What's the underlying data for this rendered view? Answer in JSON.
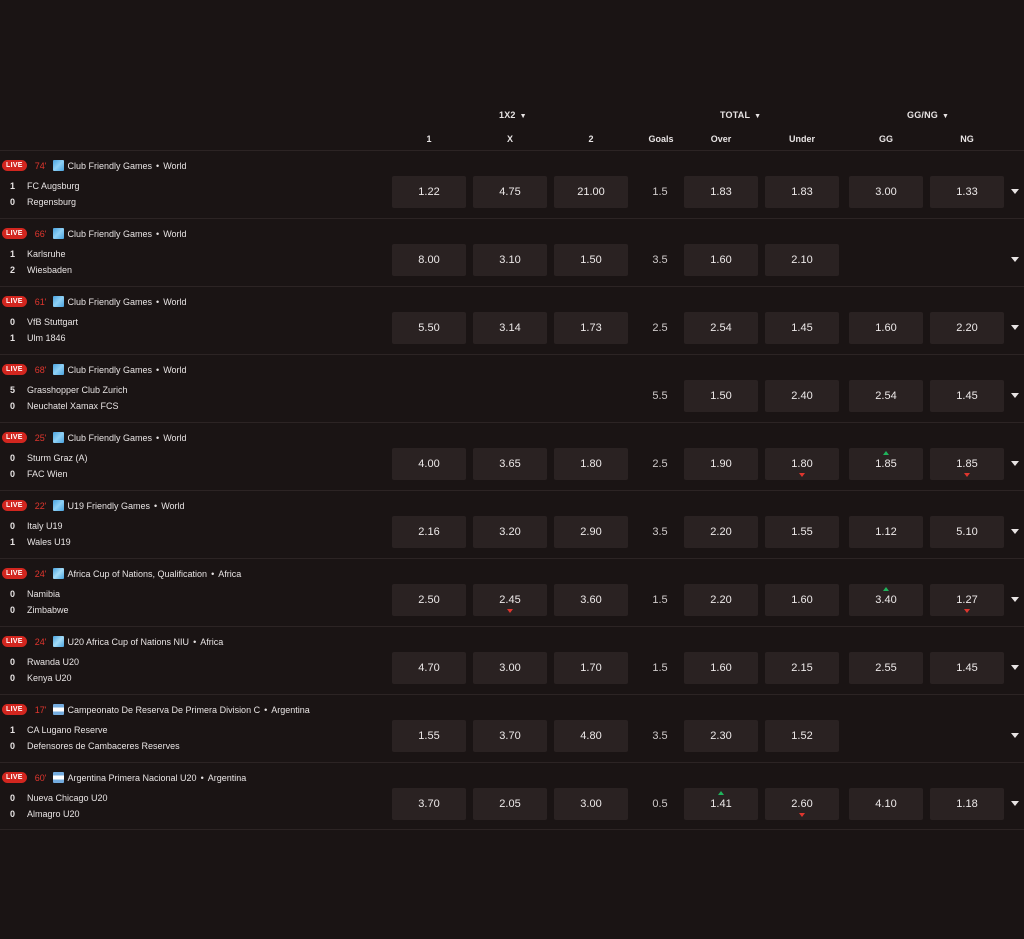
{
  "header": {
    "groups": [
      {
        "label": "1X2",
        "arrow": "▼"
      },
      {
        "label": "TOTAL",
        "arrow": "▼"
      },
      {
        "label": "GG/NG",
        "arrow": "▼"
      }
    ],
    "columns": [
      "1",
      "X",
      "2",
      "Goals",
      "Over",
      "Under",
      "GG",
      "NG"
    ]
  },
  "live_label": "LIVE",
  "colors": {
    "live_badge": "#d2261f",
    "up": "#1fb55c",
    "down": "#e0362e",
    "odds_bg": "#2a2222",
    "page_bg": "#1a1414"
  },
  "matches": [
    {
      "minute": "74'",
      "flag": "world-flag",
      "league": "Club Friendly Games",
      "sep": "•",
      "region": "World",
      "team1": {
        "score": "1",
        "name": "FC Augsburg"
      },
      "team2": {
        "score": "0",
        "name": "Regensburg"
      },
      "odds": {
        "one": "1.22",
        "x": "4.75",
        "two": "21.00",
        "goals": "1.5",
        "over": "1.83",
        "under": "1.83",
        "gg": "3.00",
        "ng": "1.33"
      }
    },
    {
      "minute": "66'",
      "flag": "world-flag",
      "league": "Club Friendly Games",
      "sep": "•",
      "region": "World",
      "team1": {
        "score": "1",
        "name": "Karlsruhe"
      },
      "team2": {
        "score": "2",
        "name": "Wiesbaden"
      },
      "odds": {
        "one": "8.00",
        "x": "3.10",
        "two": "1.50",
        "goals": "3.5",
        "over": "1.60",
        "under": "2.10",
        "gg": null,
        "ng": null
      }
    },
    {
      "minute": "61'",
      "flag": "world-flag",
      "league": "Club Friendly Games",
      "sep": "•",
      "region": "World",
      "team1": {
        "score": "0",
        "name": "VfB Stuttgart"
      },
      "team2": {
        "score": "1",
        "name": "Ulm 1846"
      },
      "odds": {
        "one": "5.50",
        "x": "3.14",
        "two": "1.73",
        "goals": "2.5",
        "over": "2.54",
        "under": "1.45",
        "gg": "1.60",
        "ng": "2.20"
      }
    },
    {
      "minute": "68'",
      "flag": "world-flag",
      "league": "Club Friendly Games",
      "sep": "•",
      "region": "World",
      "team1": {
        "score": "5",
        "name": "Grasshopper Club Zurich"
      },
      "team2": {
        "score": "0",
        "name": "Neuchatel Xamax FCS"
      },
      "odds": {
        "one": null,
        "x": null,
        "two": null,
        "goals": "5.5",
        "over": "1.50",
        "under": "2.40",
        "gg": "2.54",
        "ng": "1.45"
      }
    },
    {
      "minute": "25'",
      "flag": "world-flag",
      "league": "Club Friendly Games",
      "sep": "•",
      "region": "World",
      "team1": {
        "score": "0",
        "name": "Sturm Graz (A)"
      },
      "team2": {
        "score": "0",
        "name": "FAC Wien"
      },
      "odds": {
        "one": "4.00",
        "x": "3.65",
        "two": "1.80",
        "goals": "2.5",
        "over": "1.90",
        "under": "1.80",
        "gg": "1.85",
        "ng": "1.85"
      },
      "moves": {
        "under": "down",
        "gg": "up",
        "ng": "down"
      }
    },
    {
      "minute": "22'",
      "flag": "world-flag",
      "league": "U19 Friendly Games",
      "sep": "•",
      "region": "World",
      "team1": {
        "score": "0",
        "name": "Italy U19"
      },
      "team2": {
        "score": "1",
        "name": "Wales U19"
      },
      "odds": {
        "one": "2.16",
        "x": "3.20",
        "two": "2.90",
        "goals": "3.5",
        "over": "2.20",
        "under": "1.55",
        "gg": "1.12",
        "ng": "5.10"
      }
    },
    {
      "minute": "24'",
      "flag": "africa-flag",
      "league": "Africa Cup of Nations, Qualification",
      "sep": "•",
      "region": "Africa",
      "team1": {
        "score": "0",
        "name": "Namibia"
      },
      "team2": {
        "score": "0",
        "name": "Zimbabwe"
      },
      "odds": {
        "one": "2.50",
        "x": "2.45",
        "two": "3.60",
        "goals": "1.5",
        "over": "2.20",
        "under": "1.60",
        "gg": "3.40",
        "ng": "1.27"
      },
      "moves": {
        "x": "down",
        "gg": "up",
        "ng": "down"
      }
    },
    {
      "minute": "24'",
      "flag": "africa-flag",
      "league": "U20 Africa Cup of Nations NIU",
      "sep": "•",
      "region": "Africa",
      "team1": {
        "score": "0",
        "name": "Rwanda U20"
      },
      "team2": {
        "score": "0",
        "name": "Kenya U20"
      },
      "odds": {
        "one": "4.70",
        "x": "3.00",
        "two": "1.70",
        "goals": "1.5",
        "over": "1.60",
        "under": "2.15",
        "gg": "2.55",
        "ng": "1.45"
      }
    },
    {
      "minute": "17'",
      "flag": "argentina-flag",
      "league": "Campeonato De Reserva De Primera Division C",
      "sep": "•",
      "region": "Argentina",
      "team1": {
        "score": "1",
        "name": "CA Lugano Reserve"
      },
      "team2": {
        "score": "0",
        "name": "Defensores de Cambaceres Reserves"
      },
      "odds": {
        "one": "1.55",
        "x": "3.70",
        "two": "4.80",
        "goals": "3.5",
        "over": "2.30",
        "under": "1.52",
        "gg": null,
        "ng": null
      }
    },
    {
      "minute": "60'",
      "flag": "argentina-flag",
      "league": "Argentina Primera Nacional U20",
      "sep": "•",
      "region": "Argentina",
      "team1": {
        "score": "0",
        "name": "Nueva Chicago U20"
      },
      "team2": {
        "score": "0",
        "name": "Almagro U20"
      },
      "odds": {
        "one": "3.70",
        "x": "2.05",
        "two": "3.00",
        "goals": "0.5",
        "over": "1.41",
        "under": "2.60",
        "gg": "4.10",
        "ng": "1.18"
      },
      "moves": {
        "over": "up",
        "under": "down"
      }
    }
  ]
}
